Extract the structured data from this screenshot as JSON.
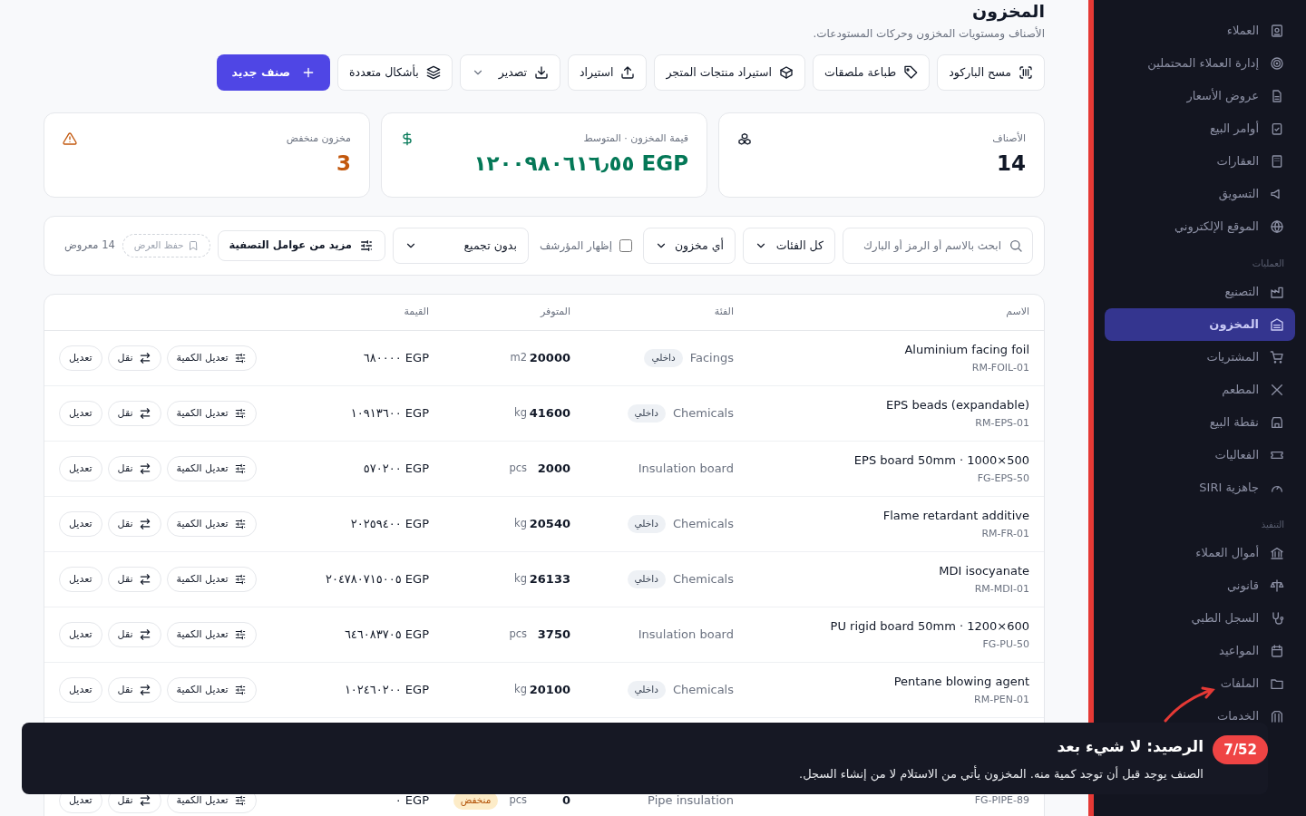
{
  "header": {
    "title": "المخزون",
    "subtitle": "الأصناف ومستويات المخزون وحركات المستودعات."
  },
  "toolbar": [
    {
      "label": "مسح الباركود",
      "kind": "plain"
    },
    {
      "label": "طباعة ملصقات",
      "kind": "plain"
    },
    {
      "label": "استيراد منتجات المتجر",
      "kind": "plain"
    },
    {
      "label": "استيراد",
      "kind": "plain"
    },
    {
      "label": "تصدير",
      "kind": "dropdown"
    },
    {
      "label": "بأشكال متعددة",
      "kind": "plain"
    },
    {
      "label": "صنف جديد",
      "kind": "primary"
    }
  ],
  "stats": [
    {
      "label": "الأصناف",
      "value": "14",
      "kind": "count"
    },
    {
      "label": "قيمة المخزون · المتوسط",
      "value": "EGP ١٢٠٠٩٨٠٦١٦٫٥٥",
      "kind": "money"
    },
    {
      "label": "مخزون منخفض",
      "value": "3",
      "kind": "warning"
    }
  ],
  "filters": {
    "search": {
      "placeholder": "ابحث بالاسم أو الرمز أو البارك"
    },
    "category": "كل الفئات",
    "stock": "أي مخزون",
    "archived": {
      "label": "إظهار المؤرشف",
      "checked": false
    },
    "grouping": "بدون تجميع",
    "more": "مزيد من عوامل التصفية",
    "save_view": "حفظ العرض",
    "count": "14 معروض"
  },
  "table": {
    "columns": [
      "الاسم",
      "الفئة",
      "المتوفر",
      "القيمة"
    ],
    "rows": [
      {
        "name": "Aluminium facing foil",
        "code": "RM-FOIL-01",
        "category": "Facings",
        "badge": {
          "label": "داخلي",
          "color": "#eef1f5"
        },
        "qty": "20000",
        "unit": "m2",
        "value": "EGP ٦٨٠٠٠٠",
        "actions": [
          "تعديل الكمية",
          "نقل",
          "تعديل"
        ]
      },
      {
        "name": "EPS beads (expandable)",
        "code": "RM-EPS-01",
        "category": "Chemicals",
        "badge": {
          "label": "داخلي",
          "color": "#eef1f5"
        },
        "qty": "41600",
        "unit": "kg",
        "value": "EGP ١٠٩١٣٦٠٠",
        "actions": [
          "تعديل الكمية",
          "نقل",
          "تعديل"
        ]
      },
      {
        "name": "EPS board 50mm · 1000×500",
        "code": "FG-EPS-50",
        "category": "Insulation board",
        "qty": "2000",
        "unit": "pcs",
        "value": "EGP ٥٧٠٢٠٠",
        "actions": [
          "تعديل الكمية",
          "نقل",
          "تعديل"
        ]
      },
      {
        "name": "Flame retardant additive",
        "code": "RM-FR-01",
        "category": "Chemicals",
        "badge": {
          "label": "داخلي",
          "color": "#eef1f5"
        },
        "qty": "20540",
        "unit": "kg",
        "value": "EGP ٢٠٢٥٩٤٠٠",
        "actions": [
          "تعديل الكمية",
          "نقل",
          "تعديل"
        ]
      },
      {
        "name": "MDI isocyanate",
        "code": "RM-MDI-01",
        "category": "Chemicals",
        "badge": {
          "label": "داخلي",
          "color": "#eef1f5"
        },
        "qty": "26133",
        "unit": "kg",
        "value": "EGP ٢٠٤٧٨٠٧١٥٠٠٥",
        "actions": [
          "تعديل الكمية",
          "نقل",
          "تعديل"
        ]
      },
      {
        "name": "PU rigid board 50mm · 1200×600",
        "code": "FG-PU-50",
        "category": "Insulation board",
        "qty": "3750",
        "unit": "pcs",
        "value": "EGP ٦٤٦٠٨٣٧٠٥",
        "actions": [
          "تعديل الكمية",
          "نقل",
          "تعديل"
        ]
      },
      {
        "name": "Pentane blowing agent",
        "code": "RM-PEN-01",
        "category": "Chemicals",
        "badge": {
          "label": "داخلي",
          "color": "#eef1f5"
        },
        "qty": "20100",
        "unit": "kg",
        "value": "EGP ١٠٢٤٦٠٢٠٠",
        "actions": [
          "تعديل الكمية",
          "نقل",
          "تعديل"
        ]
      },
      {
        "code": "FG-PIPE-89",
        "category": "Pipe insulation",
        "qty": "0",
        "unit": "pcs",
        "stock_badge": {
          "label": "منخفض",
          "color": "#fdecc8"
        },
        "value": "EGP ٠",
        "actions": [
          "تعديل الكمية",
          "نقل",
          "تعديل"
        ]
      }
    ]
  },
  "sidebar": [
    {
      "kind": "item",
      "label": "العملاء",
      "selected": false
    },
    {
      "kind": "item",
      "label": "إدارة العملاء المحتملين",
      "selected": false
    },
    {
      "kind": "item",
      "label": "عروض الأسعار",
      "selected": false
    },
    {
      "kind": "item",
      "label": "أوامر البيع",
      "selected": false
    },
    {
      "kind": "item",
      "label": "العقارات",
      "selected": false
    },
    {
      "kind": "item",
      "label": "التسويق",
      "selected": false
    },
    {
      "kind": "item",
      "label": "الموقع الإلكتروني",
      "selected": false
    },
    {
      "kind": "section",
      "label": "العمليات"
    },
    {
      "kind": "item",
      "label": "التصنيع",
      "selected": false
    },
    {
      "kind": "item",
      "label": "المخزون",
      "selected": true
    },
    {
      "kind": "item",
      "label": "المشتريات",
      "selected": false
    },
    {
      "kind": "item",
      "label": "المطعم",
      "selected": false
    },
    {
      "kind": "item",
      "label": "نقطة البيع",
      "selected": false
    },
    {
      "kind": "item",
      "label": "الفعاليات",
      "selected": false
    },
    {
      "kind": "item",
      "label": "جاهزية SIRI",
      "selected": false
    },
    {
      "kind": "section",
      "label": "التنفيذ"
    },
    {
      "kind": "item",
      "label": "أموال العملاء",
      "selected": false
    },
    {
      "kind": "item",
      "label": "قانوني",
      "selected": false
    },
    {
      "kind": "item",
      "label": "السجل الطبي",
      "selected": false
    },
    {
      "kind": "item",
      "label": "المواعيد",
      "selected": false
    },
    {
      "kind": "item",
      "label": "الملفات",
      "selected": false
    },
    {
      "kind": "item",
      "label": "الخدمات",
      "selected": false
    }
  ],
  "tour": {
    "step": "7/52",
    "title": "الرصيد: لا شيء بعد",
    "body": "الصنف يوجد قبل أن توجد كمية منه. المخزون يأتي من الاستلام لا من إنشاء السجل."
  }
}
